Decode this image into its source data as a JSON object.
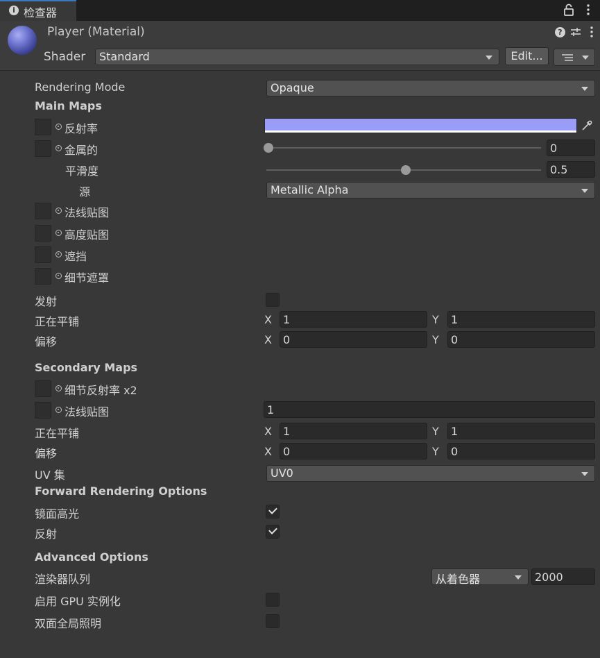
{
  "window": {
    "tab_title": "检查器"
  },
  "header": {
    "material_title": "Player (Material)",
    "shader_label": "Shader",
    "shader_value": "Standard",
    "edit_label": "Edit..."
  },
  "rendering_mode": {
    "label": "Rendering Mode",
    "value": "Opaque"
  },
  "main_maps": {
    "title": "Main Maps",
    "albedo_label": "反射率",
    "albedo_color": "#9a9df8",
    "metallic_label": "金属的",
    "metallic_value": "0",
    "metallic_level": 0.0,
    "smoothness_label": "平滑度",
    "smoothness_value": "0.5",
    "smoothness_level": 0.5,
    "source_label": "源",
    "source_value": "Metallic Alpha",
    "normal_label": "法线贴图",
    "height_label": "高度贴图",
    "occlusion_label": "遮挡",
    "detail_mask_label": "细节遮罩",
    "emission_label": "发射",
    "emission_checked": false,
    "tiling_label": "正在平铺",
    "tiling_x": "1",
    "tiling_y": "1",
    "offset_label": "偏移",
    "offset_x": "0",
    "offset_y": "0",
    "x_label": "X",
    "y_label": "Y"
  },
  "secondary_maps": {
    "title": "Secondary Maps",
    "detail_albedo_label": "细节反射率 x2",
    "normal_label": "法线贴图",
    "normal_scale": "1",
    "tiling_label": "正在平铺",
    "tiling_x": "1",
    "tiling_y": "1",
    "offset_label": "偏移",
    "offset_x": "0",
    "offset_y": "0",
    "uv_set_label": "UV 集",
    "uv_set_value": "UV0",
    "x_label": "X",
    "y_label": "Y"
  },
  "forward_rendering": {
    "title": "Forward Rendering Options",
    "specular_label": "镜面高光",
    "specular_checked": true,
    "reflections_label": "反射",
    "reflections_checked": true
  },
  "advanced": {
    "title": "Advanced Options",
    "render_queue_label": "渲染器队列",
    "render_queue_mode": "从着色器",
    "render_queue_value": "2000",
    "gpu_instancing_label": "启用 GPU 实例化",
    "gpu_instancing_checked": false,
    "double_sided_gi_label": "双面全局照明",
    "double_sided_gi_checked": false
  }
}
